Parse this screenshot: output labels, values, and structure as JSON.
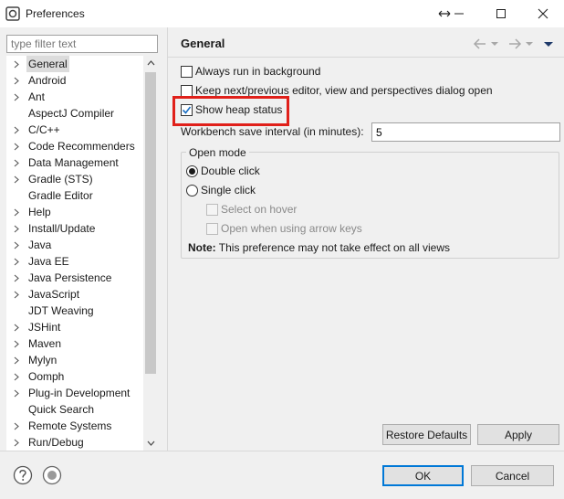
{
  "window": {
    "title": "Preferences",
    "controls": {
      "restore_glyph": "↔",
      "minimize_glyph": "—",
      "maximize_glyph": "☐",
      "close_glyph": "✕"
    }
  },
  "filter": {
    "placeholder": "type filter text",
    "value": ""
  },
  "tree": {
    "items": [
      {
        "label": "General",
        "expandable": true,
        "selected": true
      },
      {
        "label": "Android",
        "expandable": true
      },
      {
        "label": "Ant",
        "expandable": true
      },
      {
        "label": "AspectJ Compiler",
        "expandable": false
      },
      {
        "label": "C/C++",
        "expandable": true
      },
      {
        "label": "Code Recommenders",
        "expandable": true
      },
      {
        "label": "Data Management",
        "expandable": true
      },
      {
        "label": "Gradle (STS)",
        "expandable": true
      },
      {
        "label": "Gradle Editor",
        "expandable": false
      },
      {
        "label": "Help",
        "expandable": true
      },
      {
        "label": "Install/Update",
        "expandable": true
      },
      {
        "label": "Java",
        "expandable": true
      },
      {
        "label": "Java EE",
        "expandable": true
      },
      {
        "label": "Java Persistence",
        "expandable": true
      },
      {
        "label": "JavaScript",
        "expandable": true
      },
      {
        "label": "JDT Weaving",
        "expandable": false
      },
      {
        "label": "JSHint",
        "expandable": true
      },
      {
        "label": "Maven",
        "expandable": true
      },
      {
        "label": "Mylyn",
        "expandable": true
      },
      {
        "label": "Oomph",
        "expandable": true
      },
      {
        "label": "Plug-in Development",
        "expandable": true
      },
      {
        "label": "Quick Search",
        "expandable": false
      },
      {
        "label": "Remote Systems",
        "expandable": true
      },
      {
        "label": "Run/Debug",
        "expandable": true
      }
    ]
  },
  "page": {
    "title": "General",
    "options": {
      "always_run_background": {
        "label": "Always run in background",
        "checked": false
      },
      "keep_next_previous": {
        "label": "Keep next/previous editor, view and perspectives dialog open",
        "checked": false
      },
      "show_heap_status": {
        "label": "Show heap status",
        "checked": true
      }
    },
    "save_interval": {
      "label": "Workbench save interval (in minutes):",
      "value": "5"
    },
    "open_mode": {
      "title": "Open mode",
      "double_click": {
        "label": "Double click",
        "selected": true
      },
      "single_click": {
        "label": "Single click",
        "selected": false
      },
      "select_on_hover": {
        "label": "Select on hover",
        "enabled": false
      },
      "open_arrow_keys": {
        "label": "Open when using arrow keys",
        "enabled": false
      }
    },
    "note": {
      "prefix": "Note:",
      "text": " This preference may not take effect on all views"
    }
  },
  "buttons": {
    "restore_defaults": "Restore Defaults",
    "apply": "Apply",
    "ok": "OK",
    "cancel": "Cancel"
  },
  "colors": {
    "highlight": "#e0201a",
    "check": "#1a6fc4",
    "primary_border": "#0078d7"
  }
}
